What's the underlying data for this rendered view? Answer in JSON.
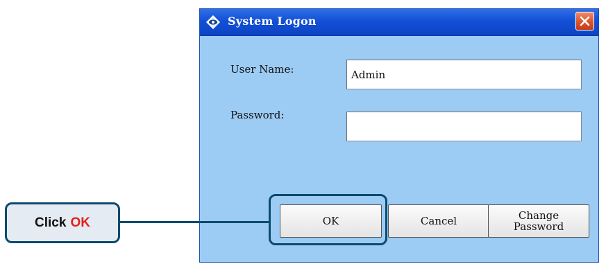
{
  "dialog": {
    "title": "System Logon",
    "close_icon": "close-icon",
    "app_icon": "diamond-eye-icon"
  },
  "form": {
    "username_label": "User Name:",
    "username_value": "Admin",
    "password_label": "Password:",
    "password_value": ""
  },
  "buttons": {
    "ok": "OK",
    "cancel": "Cancel",
    "change_line1": "Change",
    "change_line2": "Password"
  },
  "callout": {
    "text_part1": "Click",
    "text_part2": "OK"
  },
  "colors": {
    "window_bg": "#9ccbf3",
    "titlebar": "#1350d6",
    "callout_border": "#0b4a6e",
    "callout_accent": "#e3201b"
  }
}
